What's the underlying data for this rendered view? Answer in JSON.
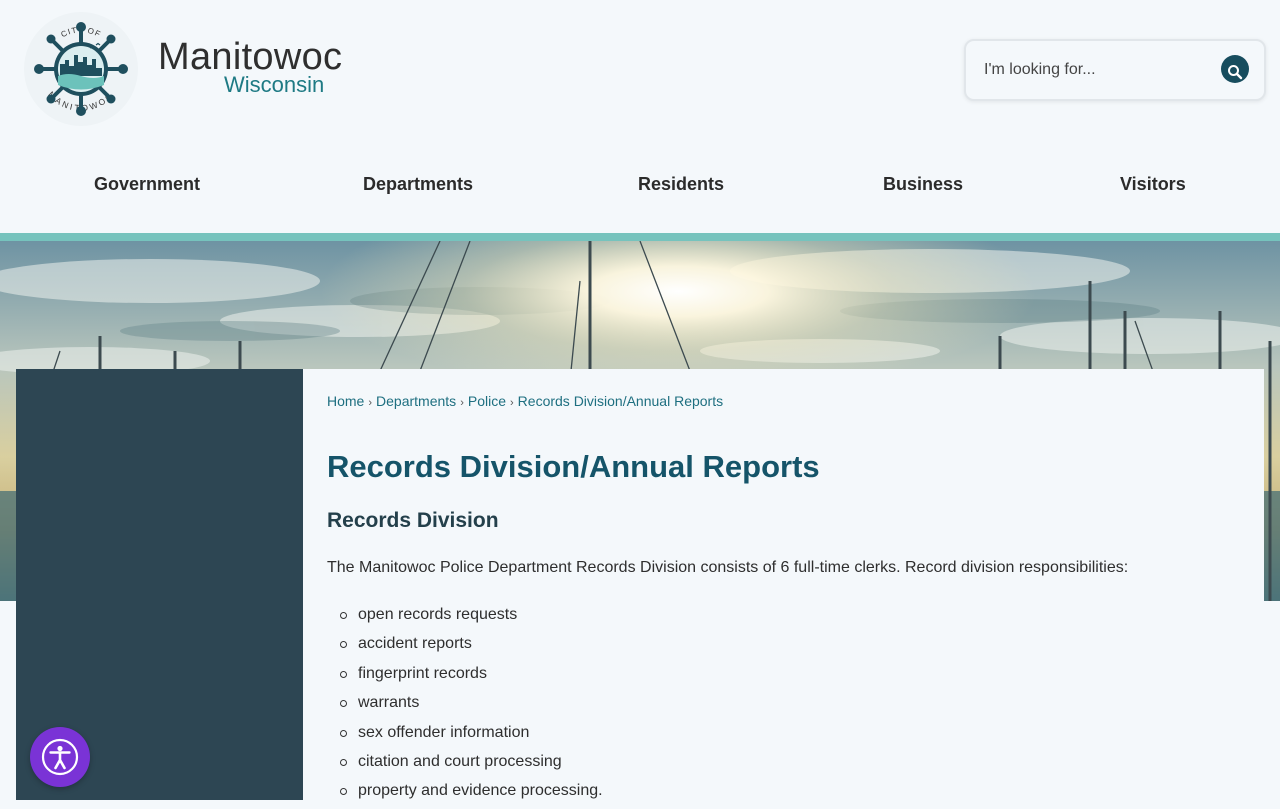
{
  "brand": {
    "name": "Manitowoc",
    "subtitle": "Wisconsin",
    "seal_top_text": "CITY OF",
    "seal_bottom_text": "MANITOWOC"
  },
  "search": {
    "placeholder": "I'm looking for..."
  },
  "nav": {
    "items": [
      "Government",
      "Departments",
      "Residents",
      "Business",
      "Visitors"
    ]
  },
  "breadcrumb": {
    "items": [
      "Home",
      "Departments",
      "Police",
      "Records Division/Annual Reports"
    ],
    "separator": "›"
  },
  "page": {
    "title": "Records Division/Annual Reports",
    "section_heading": "Records Division",
    "intro": "The Manitowoc Police Department Records Division consists of 6 full-time clerks. Record division responsibilities:",
    "responsibilities": [
      "open records requests",
      "accident reports",
      "fingerprint records",
      "warrants",
      "sex offender information",
      "citation and court processing",
      "property and evidence processing."
    ]
  },
  "icons": {
    "search": "search-icon",
    "accessibility": "accessibility-icon",
    "seal": "city-seal-logo"
  },
  "colors": {
    "primary": "#155469",
    "accent": "#76c3bd",
    "sidebar": "#2d4653",
    "accessibility": "#7a33d6",
    "link": "#1e6f80"
  }
}
